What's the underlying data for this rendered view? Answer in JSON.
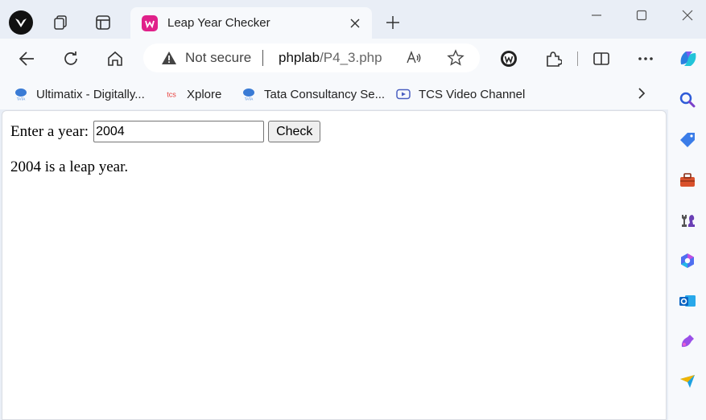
{
  "tab": {
    "title": "Leap Year Checker",
    "favicon": "wamp-icon",
    "favicon_color": "#e0218a"
  },
  "address_bar": {
    "security_label": "Not secure",
    "host": "phplab",
    "path": "/P4_3.php"
  },
  "bookmarks": [
    {
      "label": "Ultimatix - Digitally...",
      "icon": "tata-logo-icon"
    },
    {
      "label": "Xplore",
      "icon": "tcs-logo-icon"
    },
    {
      "label": "Tata Consultancy Se...",
      "icon": "tata-logo-icon"
    },
    {
      "label": "TCS Video Channel",
      "icon": "video-play-icon"
    }
  ],
  "page": {
    "prompt_label": "Enter a year:",
    "year_value": "2004",
    "check_label": "Check",
    "result_text": "2004 is a leap year."
  },
  "sidebar": [
    "search-icon",
    "tag-icon",
    "toolbox-icon",
    "chess-icon",
    "microsoft365-icon",
    "outlook-icon",
    "designer-icon",
    "send-icon"
  ]
}
